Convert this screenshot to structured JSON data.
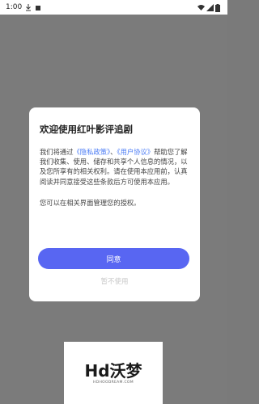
{
  "status_bar": {
    "time": "1:00",
    "icons": [
      "download-icon",
      "square-icon",
      "wifi-icon",
      "signal-icon",
      "battery-icon"
    ]
  },
  "dialog": {
    "title": "欢迎使用红叶影评追剧",
    "body_prefix": "我们将通过",
    "privacy_link": "《隐私政策》",
    "separator": "、",
    "agreement_link": "《用户协议》",
    "body_rest": "帮助您了解我们收集、使用、储存和共享个人信息的情况，以及您所享有的相关权利。请在使用本应用前，认真阅读并同意接受这些条款后方可使用本应用。",
    "note": "您可以在相关界面管理您的授权。",
    "agree_label": "同意",
    "decline_label": "暂不使用"
  },
  "watermark": {
    "logo": "Hd沃梦",
    "subtitle": "HDHOODREAM.COM"
  },
  "colors": {
    "accent": "#5866f2",
    "link": "#4a7bf5",
    "overlay": "#7b7b7b"
  }
}
